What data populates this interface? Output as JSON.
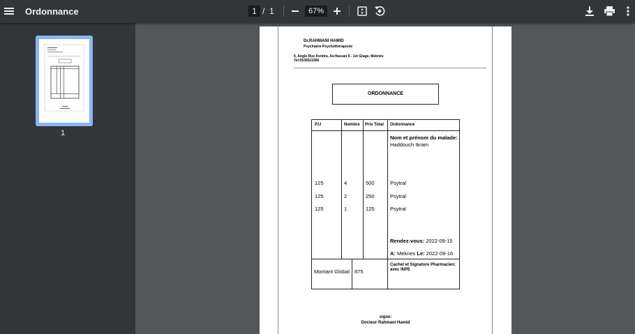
{
  "toolbar": {
    "title": "Ordonnance",
    "current_page": "1",
    "page_sep": "/",
    "total_pages": "1",
    "zoom": "67%",
    "icons": [
      "menu-icon",
      "zoom-out-icon",
      "zoom-in-icon",
      "fit-page-icon",
      "rotate-icon",
      "download-icon",
      "print-icon",
      "more-icon"
    ]
  },
  "sidebar": {
    "thumb_label": "1"
  },
  "doc": {
    "doctor_name": "Dr.RAHMANI HAMID",
    "specialty": "Psychiatre-Psychothérapeute",
    "address": "6, Angle Rue Kenitra, Av.Hassan II - 1ér Etage, Meknès",
    "phone": "Tel:0535523366",
    "heading": "ORDONNANCE",
    "table": {
      "headers": [
        "P.U",
        "Nombre",
        "Prix Total",
        "Ordonnance"
      ],
      "patient_label": "Nom et prénom du malade:",
      "patient_name": "Haddouch Ikram",
      "rows": [
        {
          "pu": "125",
          "nombre": "4",
          "total": "500",
          "med": "Psytral"
        },
        {
          "pu": "125",
          "nombre": "2",
          "total": "250",
          "med": "Psytral"
        },
        {
          "pu": "125",
          "nombre": "1",
          "total": "125",
          "med": "Psytral"
        }
      ],
      "rdv_label": "Rendez-vous:",
      "rdv_date": "2022-09-15",
      "a_label": "A:",
      "a_city": "Meknes",
      "le_label": "Le:",
      "le_date": "2022-09-16",
      "montant_label": "Montant Global",
      "montant_value": "875",
      "cachet": "Cachet et Signature Pharmacien:",
      "cachet2": "avec INPE"
    },
    "signe": "signe:",
    "signer": "Docteur Rahmani Hamid"
  }
}
